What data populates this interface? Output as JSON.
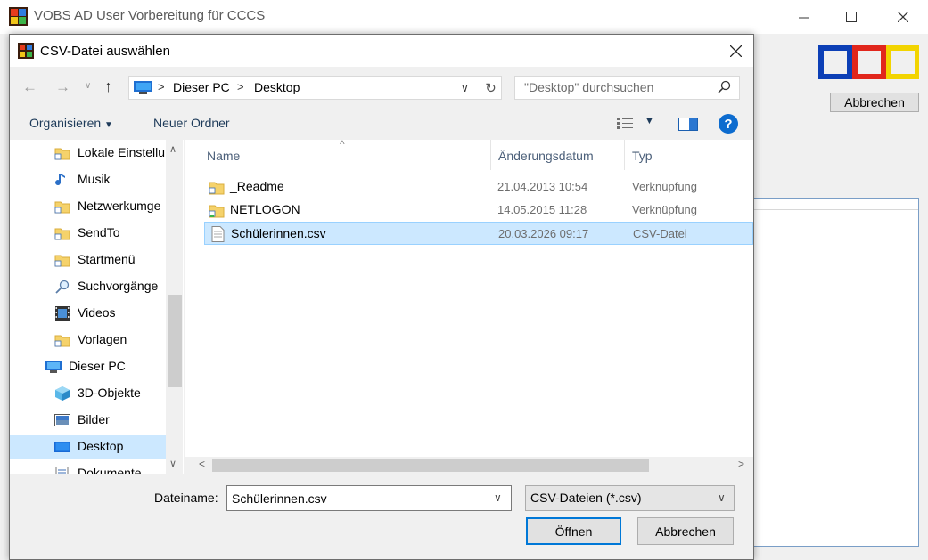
{
  "main_window": {
    "title": "VOBS AD User Vorbereitung für CCCS",
    "cancel_label": "Abbrechen",
    "logo_colors": [
      "#0c3fb6",
      "#e1261c",
      "#f2d400"
    ]
  },
  "dialog": {
    "title": "CSV-Datei auswählen",
    "address": {
      "crumbs": [
        "Dieser PC",
        "Desktop"
      ]
    },
    "search_placeholder": "\"Desktop\" durchsuchen",
    "toolbar": {
      "organize_label": "Organisieren",
      "new_folder_label": "Neuer Ordner"
    },
    "nav_items": [
      {
        "label": "Lokale Einstellu",
        "icon": "folder-shortcut-icon"
      },
      {
        "label": "Musik",
        "icon": "music-note-icon"
      },
      {
        "label": "Netzwerkumge",
        "icon": "folder-shortcut-icon"
      },
      {
        "label": "SendTo",
        "icon": "folder-shortcut-icon"
      },
      {
        "label": "Startmenü",
        "icon": "folder-shortcut-icon"
      },
      {
        "label": "Suchvorgänge",
        "icon": "search-icon"
      },
      {
        "label": "Videos",
        "icon": "film-icon"
      },
      {
        "label": "Vorlagen",
        "icon": "folder-shortcut-icon"
      },
      {
        "label": "Dieser PC",
        "icon": "computer-icon"
      },
      {
        "label": "3D-Objekte",
        "icon": "cube-icon"
      },
      {
        "label": "Bilder",
        "icon": "pictures-icon"
      },
      {
        "label": "Desktop",
        "icon": "desktop-icon",
        "selected": true
      },
      {
        "label": "Dokumente",
        "icon": "document-icon"
      }
    ],
    "columns": {
      "name": "Name",
      "date": "Änderungsdatum",
      "type": "Typ"
    },
    "files": [
      {
        "name": "_Readme",
        "date": "21.04.2013 10:54",
        "type": "Verknüpfung",
        "icon": "folder-shortcut-icon"
      },
      {
        "name": "NETLOGON",
        "date": "14.05.2015 11:28",
        "type": "Verknüpfung",
        "icon": "network-folder-icon"
      },
      {
        "name": "Schülerinnen.csv",
        "date": "20.03.2026 09:17",
        "type": "CSV-Datei",
        "icon": "csv-file-icon",
        "selected": true
      }
    ],
    "filename_label": "Dateiname:",
    "filename_value": "Schülerinnen.csv",
    "filter_value": "CSV-Dateien (*.csv)",
    "open_label": "Öffnen",
    "cancel_label": "Abbrechen"
  }
}
